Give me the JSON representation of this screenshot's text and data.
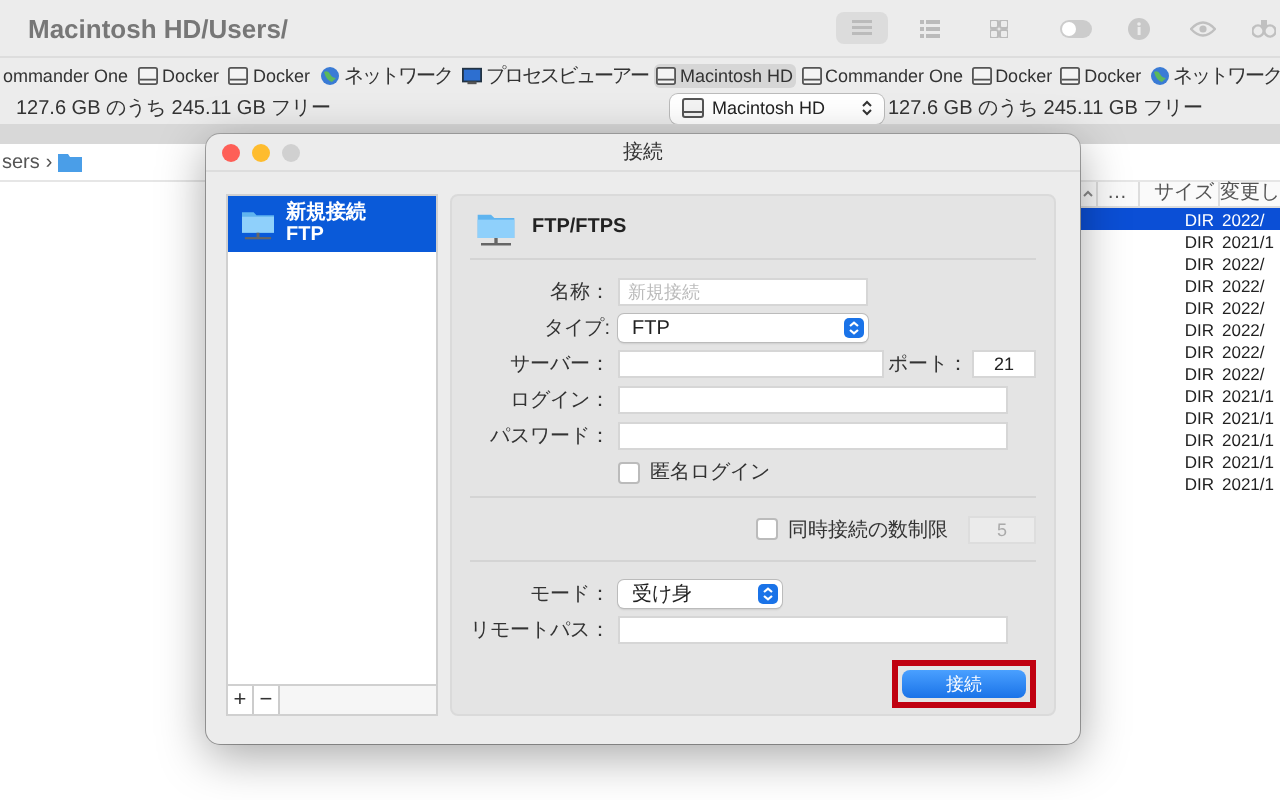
{
  "window": {
    "title": "Macintosh HD/Users/"
  },
  "toolbar": {
    "view_buttons": [
      {
        "kind": "list",
        "selected": true
      },
      {
        "kind": "detail",
        "selected": false
      },
      {
        "kind": "grid",
        "selected": false
      }
    ],
    "toggle": {
      "on": false
    }
  },
  "left_pane": {
    "bookmarks": [
      {
        "label": "ommander One",
        "kind": "disk",
        "selected": false
      },
      {
        "label": "Docker",
        "kind": "disk",
        "selected": false
      },
      {
        "label": "Docker",
        "kind": "disk",
        "selected": false
      },
      {
        "label": "ネットワーク",
        "kind": "network",
        "selected": false
      },
      {
        "label": "プロセスビューアー",
        "kind": "monitor",
        "selected": false
      }
    ],
    "free_space": "127.6 GB のうち 245.11 GB フリー",
    "path": "sers",
    "path_separator": "›"
  },
  "right_pane": {
    "bookmarks": [
      {
        "label": "Macintosh HD",
        "kind": "disk",
        "selected": true
      },
      {
        "label": "Commander One",
        "kind": "disk",
        "selected": false
      },
      {
        "label": "Docker",
        "kind": "disk",
        "selected": false
      },
      {
        "label": "Docker",
        "kind": "disk",
        "selected": false
      },
      {
        "label": "ネットワーク",
        "kind": "network",
        "selected": false
      }
    ],
    "drive": "Macintosh HD",
    "free_space": "127.6 GB のうち 245.11 GB フリー",
    "columns": [
      "…",
      "サイズ",
      "変更し"
    ],
    "rows": [
      {
        "size": "DIR",
        "modified": "2022/",
        "selected": true
      },
      {
        "size": "DIR",
        "modified": "2021/1",
        "selected": false
      },
      {
        "size": "DIR",
        "modified": "2022/",
        "selected": false
      },
      {
        "size": "DIR",
        "modified": "2022/",
        "selected": false
      },
      {
        "size": "DIR",
        "modified": "2022/",
        "selected": false
      },
      {
        "size": "DIR",
        "modified": "2022/",
        "selected": false
      },
      {
        "size": "DIR",
        "modified": "2022/",
        "selected": false
      },
      {
        "size": "DIR",
        "modified": "2022/",
        "selected": false
      },
      {
        "size": "DIR",
        "modified": "2021/1",
        "selected": false
      },
      {
        "size": "DIR",
        "modified": "2021/1",
        "selected": false
      },
      {
        "size": "DIR",
        "modified": "2021/1",
        "selected": false
      },
      {
        "size": "DIR",
        "modified": "2021/1",
        "selected": false
      },
      {
        "size": "DIR",
        "modified": "2021/1",
        "selected": false
      }
    ]
  },
  "dialog": {
    "title": "接続",
    "connections": [
      {
        "name": "新規接続",
        "type": "FTP",
        "selected": true
      }
    ],
    "protocol": "FTP/FTPS",
    "form": {
      "name": {
        "label": "名称：",
        "placeholder": "新規接続"
      },
      "type": {
        "label": "タイプ:",
        "value": "FTP"
      },
      "server": {
        "label": "サーバー："
      },
      "port": {
        "label": "ポート：",
        "value": "21"
      },
      "login": {
        "label": "ログイン："
      },
      "password": {
        "label": "パスワード："
      },
      "anonymous": {
        "label": "匿名ログイン",
        "checked": false
      },
      "limit": {
        "label": "同時接続の数制限",
        "checked": false,
        "value": "5"
      },
      "mode": {
        "label": "モード：",
        "value": "受け身"
      },
      "remote_path": {
        "label": "リモートパス："
      }
    },
    "list_buttons": [
      "+",
      "−"
    ],
    "connect_button": {
      "label": "接続",
      "highlighted": true
    }
  }
}
